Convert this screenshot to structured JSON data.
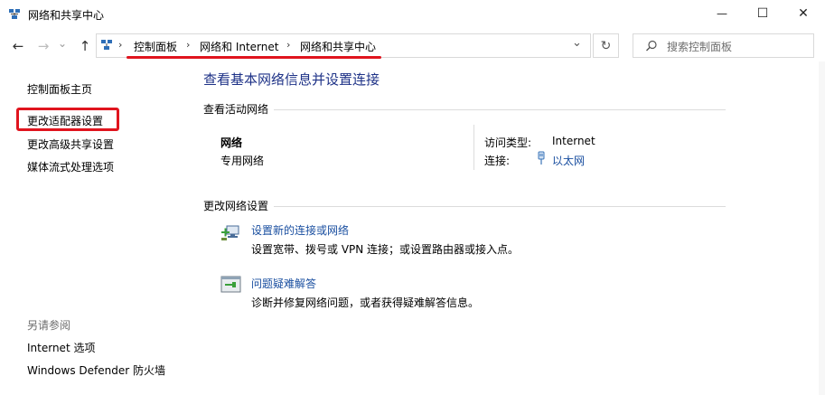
{
  "window": {
    "title": "网络和共享中心",
    "minimize": "—",
    "maximize": "☐",
    "close": "✕"
  },
  "toolbar": {
    "back": "←",
    "forward": "→",
    "recent": "⌄",
    "up": "↑",
    "refresh": "↻"
  },
  "breadcrumb": {
    "separator": "›",
    "items": [
      "控制面板",
      "网络和 Internet",
      "网络和共享中心"
    ],
    "dropdown": "⌄"
  },
  "search": {
    "placeholder": "搜索控制面板"
  },
  "sidebar": {
    "home": "控制面板主页",
    "items": [
      "更改适配器设置",
      "更改高级共享设置",
      "媒体流式处理选项"
    ],
    "see_also_title": "另请参阅",
    "see_also": [
      "Internet 选项",
      "Windows Defender 防火墙"
    ]
  },
  "main": {
    "heading": "查看基本网络信息并设置连接",
    "active_networks_title": "查看活动网络",
    "network": {
      "name": "网络",
      "profile": "专用网络",
      "access_type_label": "访问类型:",
      "access_type_value": "Internet",
      "connection_label": "连接:",
      "connection_value": "以太网"
    },
    "change_settings_title": "更改网络设置",
    "tasks": [
      {
        "title": "设置新的连接或网络",
        "desc": "设置宽带、拨号或 VPN 连接；或设置路由器或接入点。"
      },
      {
        "title": "问题疑难解答",
        "desc": "诊断并修复网络问题，或者获得疑难解答信息。"
      }
    ]
  },
  "colors": {
    "accent_heading": "#1e3287",
    "link": "#1a4fa0",
    "annotation_red": "#e0141e"
  }
}
